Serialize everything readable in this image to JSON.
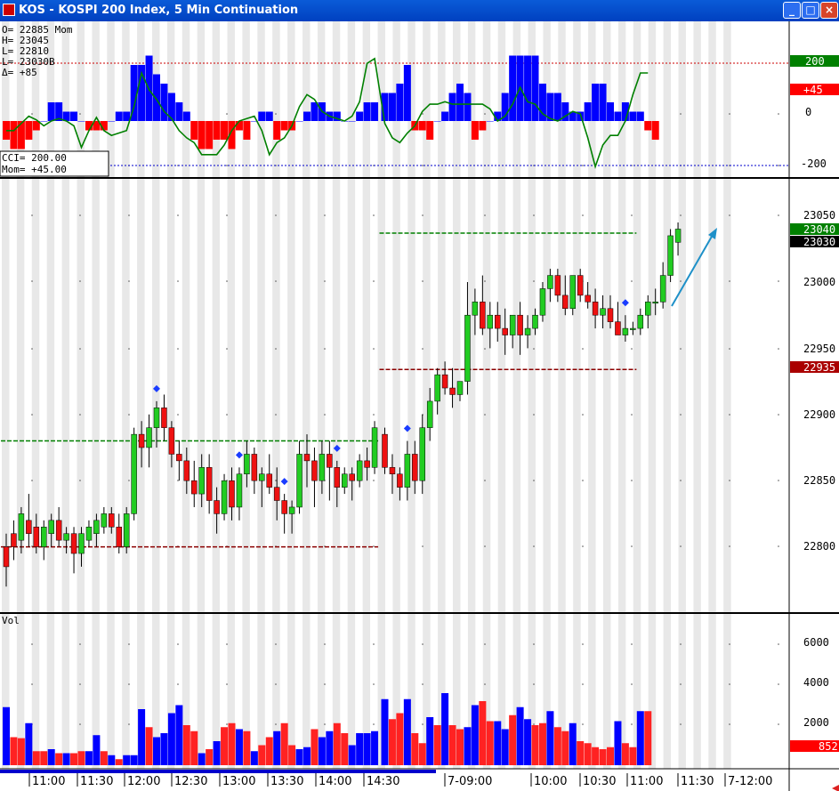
{
  "window": {
    "title": "KOS - KOSPI 200 Index, 5 Min Continuation",
    "minimize_glyph": "_",
    "maximize_glyph": "□",
    "close_glyph": "×"
  },
  "readout": {
    "lines": [
      "O=  22885  Mom",
      "H=  23045",
      "L=  22810",
      "L=  23030B",
      "Δ=    +85"
    ],
    "cci_line": "CCI=     200.00",
    "mom_line": "Mom=     +45.00"
  },
  "osc_panel": {
    "scale_labels": [
      "0",
      "-200"
    ],
    "badge_top": "200",
    "badge_mid": "+45",
    "badge_top_color": "#008000",
    "badge_mid_color": "#ff0000",
    "mom_values": [
      -2,
      -3,
      -3,
      -2,
      -1,
      0,
      2,
      2,
      1,
      1,
      0,
      -1,
      -1,
      -1,
      0,
      1,
      1,
      6,
      6,
      7,
      5,
      4,
      3,
      2,
      1,
      -2,
      -3,
      -3,
      -2,
      -2,
      -3,
      -1,
      -2,
      0,
      1,
      1,
      -2,
      -1,
      -1,
      0,
      1,
      2,
      2,
      1,
      1,
      0,
      0,
      1,
      2,
      2,
      3,
      3,
      4,
      6,
      -1,
      -1,
      -2,
      0,
      1,
      3,
      4,
      3,
      -2,
      -1,
      0,
      1,
      3,
      7,
      7,
      7,
      7,
      4,
      3,
      3,
      2,
      1,
      1,
      2,
      4,
      4,
      2,
      1,
      2,
      1,
      1,
      -1,
      -2,
      -2,
      -1,
      -1,
      -2,
      1,
      2,
      4,
      3
    ],
    "cci_values": [
      -40,
      -40,
      -10,
      20,
      5,
      -20,
      0,
      10,
      0,
      -20,
      -110,
      -40,
      15,
      -40,
      -60,
      -50,
      -40,
      60,
      200,
      130,
      90,
      40,
      10,
      -40,
      -70,
      -90,
      -140,
      -140,
      -140,
      -100,
      -40,
      0,
      10,
      20,
      -40,
      -140,
      -90,
      -70,
      -20,
      60,
      110,
      90,
      40,
      20,
      10,
      0,
      20,
      80,
      240,
      260,
      -10,
      -70,
      -90,
      -50,
      -20,
      40,
      70,
      70,
      80,
      70,
      70,
      70,
      70,
      70,
      50,
      0,
      20,
      70,
      140,
      80,
      70,
      30,
      10,
      0,
      20,
      40,
      30,
      -70,
      -190,
      -100,
      -60,
      -60,
      0,
      110,
      200,
      200
    ]
  },
  "price_panel": {
    "price_labels": [
      "23050",
      "23000",
      "22950",
      "22900",
      "22850",
      "22800"
    ],
    "marker_labels": [
      "23040",
      "23030",
      "22935"
    ],
    "marker_colors": [
      "#008000",
      "#000000",
      "#aa0000"
    ],
    "candles": [
      [
        22800,
        22810,
        22770,
        22785
      ],
      [
        22810,
        22820,
        22790,
        22800
      ],
      [
        22805,
        22830,
        22795,
        22825
      ],
      [
        22820,
        22840,
        22800,
        22810
      ],
      [
        22815,
        22825,
        22795,
        22800
      ],
      [
        22800,
        22820,
        22790,
        22815
      ],
      [
        22810,
        22825,
        22800,
        22820
      ],
      [
        22820,
        22830,
        22800,
        22805
      ],
      [
        22805,
        22815,
        22795,
        22810
      ],
      [
        22810,
        22815,
        22780,
        22795
      ],
      [
        22795,
        22815,
        22785,
        22810
      ],
      [
        22805,
        22820,
        22800,
        22815
      ],
      [
        22810,
        22825,
        22800,
        22820
      ],
      [
        22815,
        22830,
        22810,
        22825
      ],
      [
        22825,
        22830,
        22810,
        22815
      ],
      [
        22815,
        22825,
        22795,
        22800
      ],
      [
        22800,
        22830,
        22795,
        22825
      ],
      [
        22825,
        22890,
        22820,
        22885
      ],
      [
        22885,
        22895,
        22860,
        22875
      ],
      [
        22875,
        22900,
        22860,
        22890
      ],
      [
        22890,
        22910,
        22875,
        22905
      ],
      [
        22905,
        22915,
        22880,
        22890
      ],
      [
        22890,
        22895,
        22860,
        22870
      ],
      [
        22870,
        22880,
        22850,
        22865
      ],
      [
        22865,
        22875,
        22840,
        22850
      ],
      [
        22850,
        22865,
        22830,
        22840
      ],
      [
        22840,
        22870,
        22830,
        22860
      ],
      [
        22860,
        22870,
        22825,
        22835
      ],
      [
        22835,
        22845,
        22810,
        22825
      ],
      [
        22825,
        22855,
        22820,
        22850
      ],
      [
        22850,
        22860,
        22820,
        22830
      ],
      [
        22830,
        22860,
        22820,
        22855
      ],
      [
        22855,
        22880,
        22845,
        22870
      ],
      [
        22870,
        22875,
        22840,
        22850
      ],
      [
        22850,
        22860,
        22830,
        22855
      ],
      [
        22855,
        22870,
        22840,
        22845
      ],
      [
        22845,
        22860,
        22820,
        22835
      ],
      [
        22835,
        22840,
        22810,
        22825
      ],
      [
        22825,
        22835,
        22810,
        22830
      ],
      [
        22830,
        22880,
        22825,
        22870
      ],
      [
        22870,
        22885,
        22845,
        22865
      ],
      [
        22865,
        22875,
        22830,
        22850
      ],
      [
        22850,
        22880,
        22840,
        22870
      ],
      [
        22870,
        22880,
        22835,
        22860
      ],
      [
        22860,
        22865,
        22830,
        22845
      ],
      [
        22845,
        22860,
        22840,
        22855
      ],
      [
        22855,
        22860,
        22835,
        22850
      ],
      [
        22850,
        22870,
        22845,
        22865
      ],
      [
        22865,
        22875,
        22850,
        22860
      ],
      [
        22860,
        22895,
        22855,
        22890
      ],
      [
        22885,
        22890,
        22855,
        22860
      ],
      [
        22860,
        22870,
        22840,
        22855
      ],
      [
        22855,
        22860,
        22835,
        22845
      ],
      [
        22845,
        22880,
        22835,
        22870
      ],
      [
        22870,
        22880,
        22840,
        22850
      ],
      [
        22850,
        22900,
        22840,
        22890
      ],
      [
        22890,
        22920,
        22880,
        22910
      ],
      [
        22910,
        22935,
        22900,
        22930
      ],
      [
        22930,
        22940,
        22915,
        22920
      ],
      [
        22920,
        22935,
        22905,
        22915
      ],
      [
        22915,
        22925,
        22910,
        22925
      ],
      [
        22925,
        23000,
        22915,
        22975
      ],
      [
        22975,
        22995,
        22960,
        22985
      ],
      [
        22985,
        23005,
        22960,
        22965
      ],
      [
        22965,
        22985,
        22950,
        22975
      ],
      [
        22975,
        22985,
        22955,
        22965
      ],
      [
        22965,
        22980,
        22945,
        22960
      ],
      [
        22960,
        22975,
        22950,
        22975
      ],
      [
        22975,
        22985,
        22945,
        22960
      ],
      [
        22960,
        22975,
        22950,
        22965
      ],
      [
        22965,
        22980,
        22960,
        22975
      ],
      [
        22975,
        23000,
        22970,
        22995
      ],
      [
        22995,
        23010,
        22985,
        23005
      ],
      [
        23005,
        23010,
        22985,
        22990
      ],
      [
        22990,
        23005,
        22975,
        22980
      ],
      [
        22980,
        23005,
        22975,
        23005
      ],
      [
        23005,
        23010,
        22985,
        22990
      ],
      [
        22990,
        23000,
        22980,
        22985
      ],
      [
        22985,
        22995,
        22965,
        22975
      ],
      [
        22975,
        22990,
        22965,
        22980
      ],
      [
        22980,
        22990,
        22965,
        22970
      ],
      [
        22970,
        22985,
        22960,
        22960
      ],
      [
        22960,
        22975,
        22955,
        22965
      ],
      [
        22965,
        22970,
        22960,
        22965
      ],
      [
        22965,
        22980,
        22960,
        22975
      ],
      [
        22975,
        22990,
        22965,
        22985
      ],
      [
        22985,
        22995,
        22975,
        22985
      ],
      [
        22985,
        23015,
        22980,
        23005
      ],
      [
        23005,
        23040,
        23000,
        23035
      ],
      [
        23030,
        23045,
        23020,
        23040
      ]
    ],
    "diamond_indices": [
      20,
      31,
      37,
      44,
      53,
      82
    ],
    "hlines": [
      {
        "price": 22880,
        "from": 0,
        "to": 49,
        "color": "#008000"
      },
      {
        "price": 22800,
        "from": 0,
        "to": 49,
        "color": "#8b0000"
      },
      {
        "price": 23037,
        "from": 50,
        "to": 83,
        "color": "#008000"
      },
      {
        "price": 22934,
        "from": 50,
        "to": 83,
        "color": "#8b0000"
      }
    ]
  },
  "vol_panel": {
    "label": "Vol",
    "scale_labels": [
      "6000",
      "4000",
      "2000"
    ],
    "badge": "852",
    "badge_color": "#ff0000",
    "volumes": [
      2900,
      1400,
      1350,
      2100,
      700,
      700,
      800,
      600,
      600,
      600,
      700,
      700,
      1500,
      700,
      500,
      300,
      500,
      500,
      2800,
      1900,
      1400,
      1600,
      2600,
      3000,
      2000,
      1700,
      600,
      800,
      1200,
      1900,
      2100,
      1800,
      1700,
      700,
      1000,
      1400,
      1700,
      2100,
      1000,
      800,
      900,
      1800,
      1400,
      1700,
      2100,
      1600,
      1000,
      1600,
      1600,
      1700,
      3300,
      2300,
      2600,
      3300,
      1600,
      1100,
      2400,
      2000,
      3600,
      2000,
      1800,
      1900,
      3000,
      3200,
      2200,
      2200,
      1800,
      2500,
      2900,
      2300,
      2000,
      2100,
      2700,
      1900,
      1700,
      2100,
      1200,
      1100,
      900,
      800,
      900,
      2200,
      1100,
      900,
      2700,
      2700
    ],
    "vol_colors": [
      "b",
      "r",
      "r",
      "b",
      "r",
      "r",
      "b",
      "r",
      "b",
      "r",
      "r",
      "b",
      "b",
      "r",
      "b",
      "r",
      "b",
      "b",
      "b",
      "r",
      "b",
      "b",
      "b",
      "b",
      "r",
      "r",
      "b",
      "r",
      "b",
      "r",
      "r",
      "b",
      "r",
      "b",
      "r",
      "r",
      "b",
      "r",
      "r",
      "b",
      "b",
      "r",
      "b",
      "b",
      "r",
      "r",
      "b",
      "b",
      "b",
      "b",
      "b",
      "r",
      "r",
      "b",
      "r",
      "r",
      "b",
      "r",
      "b",
      "r",
      "r",
      "b",
      "b",
      "r",
      "r",
      "b",
      "b",
      "r",
      "b",
      "b",
      "r",
      "r",
      "b",
      "r",
      "r",
      "b",
      "r",
      "r",
      "r",
      "r",
      "r",
      "b",
      "r",
      "r",
      "b",
      "r"
    ]
  },
  "x_axis": {
    "labels": [
      "11:00",
      "11:30",
      "12:00",
      "12:30",
      "13:00",
      "13:30",
      "14:00",
      "14:30",
      "7-09:00",
      "10:00",
      "10:30",
      "11:00",
      "11:30",
      "7-12:00"
    ]
  }
}
